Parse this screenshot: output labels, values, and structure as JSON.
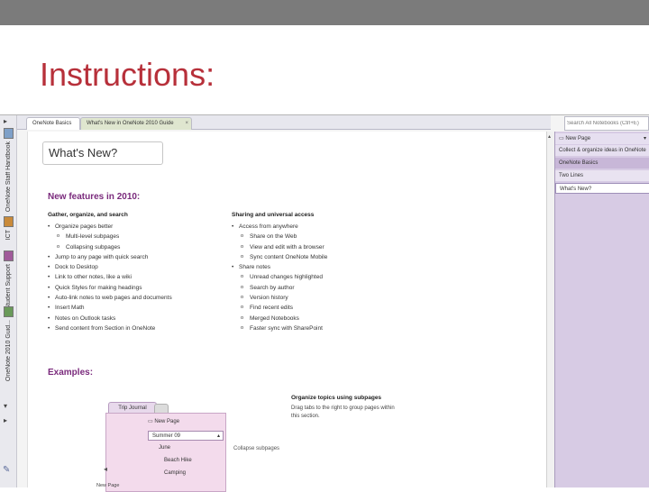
{
  "slide": {
    "title": "Instructions:"
  },
  "notebooks": [
    "OneNote Staff Handbook",
    "ICT",
    "Student Support",
    "OneNote 2010 Guid..."
  ],
  "tabs": [
    {
      "label": "OneNote Basics"
    },
    {
      "label": "What's New in OneNote 2010 Guide"
    }
  ],
  "search": {
    "placeholder": "Search All Notebooks (Ctrl+E)"
  },
  "page": {
    "title": "What's New?",
    "features_heading": "New features in 2010:",
    "left_column": {
      "heading": "Gather, organize, and search",
      "items": [
        {
          "text": "Organize pages better",
          "level": 1
        },
        {
          "text": "Multi-level subpages",
          "level": 2
        },
        {
          "text": "Collapsing subpages",
          "level": 2
        },
        {
          "text": "Jump to any page with quick search",
          "level": 1
        },
        {
          "text": "Dock to Desktop",
          "level": 1
        },
        {
          "text": "Link to other notes, like a wiki",
          "level": 1
        },
        {
          "text": "Quick Styles for making headings",
          "level": 1
        },
        {
          "text": "Auto-link notes to web pages and documents",
          "level": 1
        },
        {
          "text": "Insert Math",
          "level": 1
        },
        {
          "text": "Notes on Outlook tasks",
          "level": 1
        },
        {
          "text": "Send content from Section in OneNote",
          "level": 1
        }
      ]
    },
    "right_column": {
      "heading": "Sharing and universal access",
      "items": [
        {
          "text": "Access from anywhere",
          "level": 1
        },
        {
          "text": "Share on the Web",
          "level": 2
        },
        {
          "text": "View and edit with a browser",
          "level": 2
        },
        {
          "text": "Sync content OneNote Mobile",
          "level": 2
        },
        {
          "text": "Share notes",
          "level": 1
        },
        {
          "text": "Unread changes highlighted",
          "level": 2
        },
        {
          "text": "Search by author",
          "level": 2
        },
        {
          "text": "Version history",
          "level": 2
        },
        {
          "text": "Find recent edits",
          "level": 2
        },
        {
          "text": "Merged Notebooks",
          "level": 2
        },
        {
          "text": "Faster sync with SharePoint",
          "level": 2
        }
      ]
    },
    "examples_heading": "Examples:",
    "example": {
      "tab": "Trip Journal",
      "new_page": "New Page",
      "rows": [
        "Summer 09",
        "June",
        "Beach Hike",
        "Camping"
      ],
      "side_label": "New Page",
      "collapse_label": "Collapse subpages",
      "organize_heading": "Organize topics using subpages",
      "organize_text": "Drag tabs to the right to group pages within this section."
    }
  },
  "page_pane": {
    "new_page": "New Page",
    "pages": [
      "Collect & organize ideas in OneNote",
      "OneNote Basics",
      "Two Lines",
      "What's New?"
    ]
  }
}
